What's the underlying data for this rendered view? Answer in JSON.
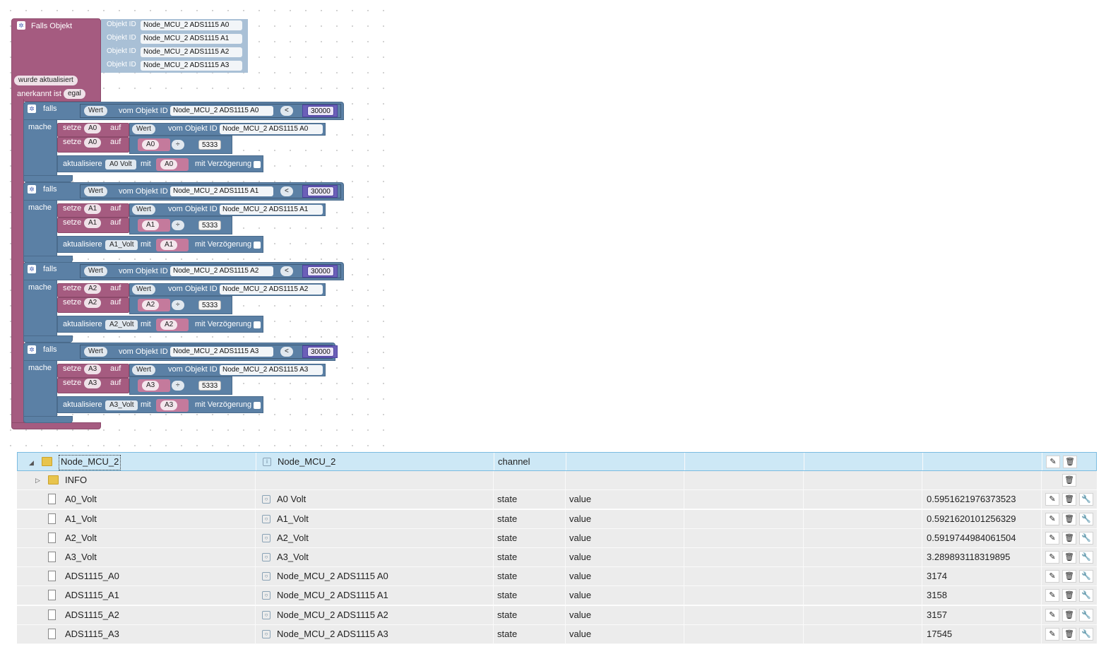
{
  "blockly": {
    "trigger": {
      "title": "Falls Objekt",
      "oid_key": "Objekt ID",
      "oids": [
        "Node_MCU_2 ADS1115  A0",
        "Node_MCU_2 ADS1115  A1",
        "Node_MCU_2 ADS1115  A2",
        "Node_MCU_2 ADS1115  A3"
      ],
      "condition": "wurde aktualisiert",
      "ack_label": "anerkannt ist",
      "ack_value": "egal"
    },
    "ifs": [
      {
        "falls": "falls",
        "mache": "mache",
        "wert": "Wert",
        "vom": "vom Objekt ID",
        "oid": "Node_MCU_2 ADS1115  A0",
        "op": "<",
        "threshold": "30000",
        "setze": "setze",
        "var": "A0",
        "auf": "auf",
        "divop": "÷",
        "divisor": "5333",
        "aktualisiere": "aktualisiere",
        "target": "A0 Volt",
        "mit": "mit",
        "delay": "mit Verzögerung"
      },
      {
        "falls": "falls",
        "mache": "mache",
        "wert": "Wert",
        "vom": "vom Objekt ID",
        "oid": "Node_MCU_2 ADS1115  A1",
        "op": "<",
        "threshold": "30000",
        "setze": "setze",
        "var": "A1",
        "auf": "auf",
        "divop": "÷",
        "divisor": "5333",
        "aktualisiere": "aktualisiere",
        "target": "A1_Volt",
        "mit": "mit",
        "delay": "mit Verzögerung"
      },
      {
        "falls": "falls",
        "mache": "mache",
        "wert": "Wert",
        "vom": "vom Objekt ID",
        "oid": "Node_MCU_2 ADS1115  A2",
        "op": "<",
        "threshold": "30000",
        "setze": "setze",
        "var": "A2",
        "auf": "auf",
        "divop": "÷",
        "divisor": "5333",
        "aktualisiere": "aktualisiere",
        "target": "A2_Volt",
        "mit": "mit",
        "delay": "mit Verzögerung"
      },
      {
        "falls": "falls",
        "mache": "mache",
        "wert": "Wert",
        "vom": "vom Objekt ID",
        "oid": "Node_MCU_2 ADS1115  A3",
        "op": "<",
        "threshold": "30000",
        "setze": "setze",
        "var": "A3",
        "auf": "auf",
        "divop": "÷",
        "divisor": "5333",
        "aktualisiere": "aktualisiere",
        "target": "A3_Volt",
        "mit": "mit",
        "delay": "mit Verzögerung"
      }
    ]
  },
  "table": {
    "rows": [
      {
        "id": "Node_MCU_2",
        "name": "Node_MCU_2",
        "type": "channel",
        "role": "",
        "value": "",
        "kind": "folder-open"
      },
      {
        "id": "INFO",
        "name": "",
        "type": "",
        "role": "",
        "value": "",
        "kind": "folder"
      },
      {
        "id": "A0_Volt",
        "name": "A0 Volt",
        "type": "state",
        "role": "value",
        "value": "0.5951621976373523",
        "kind": "file"
      },
      {
        "id": "A1_Volt",
        "name": "A1_Volt",
        "type": "state",
        "role": "value",
        "value": "0.5921620101256329",
        "kind": "file"
      },
      {
        "id": "A2_Volt",
        "name": "A2_Volt",
        "type": "state",
        "role": "value",
        "value": "0.5919744984061504",
        "kind": "file"
      },
      {
        "id": "A3_Volt",
        "name": "A3_Volt",
        "type": "state",
        "role": "value",
        "value": "3.289893118319895",
        "kind": "file"
      },
      {
        "id": "ADS1115_A0",
        "name": "Node_MCU_2 ADS1115 A0",
        "type": "state",
        "role": "value",
        "value": "3174",
        "kind": "file"
      },
      {
        "id": "ADS1115_A1",
        "name": "Node_MCU_2 ADS1115 A1",
        "type": "state",
        "role": "value",
        "value": "3158",
        "kind": "file"
      },
      {
        "id": "ADS1115_A2",
        "name": "Node_MCU_2 ADS1115 A2",
        "type": "state",
        "role": "value",
        "value": "3157",
        "kind": "file"
      },
      {
        "id": "ADS1115_A3",
        "name": "Node_MCU_2 ADS1115 A3",
        "type": "state",
        "role": "value",
        "value": "17545",
        "kind": "file"
      }
    ],
    "icons": {
      "edit": "pencil-icon",
      "delete": "trash-icon",
      "settings": "wrench-icon",
      "expand": "triangle-icon",
      "folder": "folder-icon",
      "file": "file-icon",
      "name": "name-icon"
    }
  }
}
